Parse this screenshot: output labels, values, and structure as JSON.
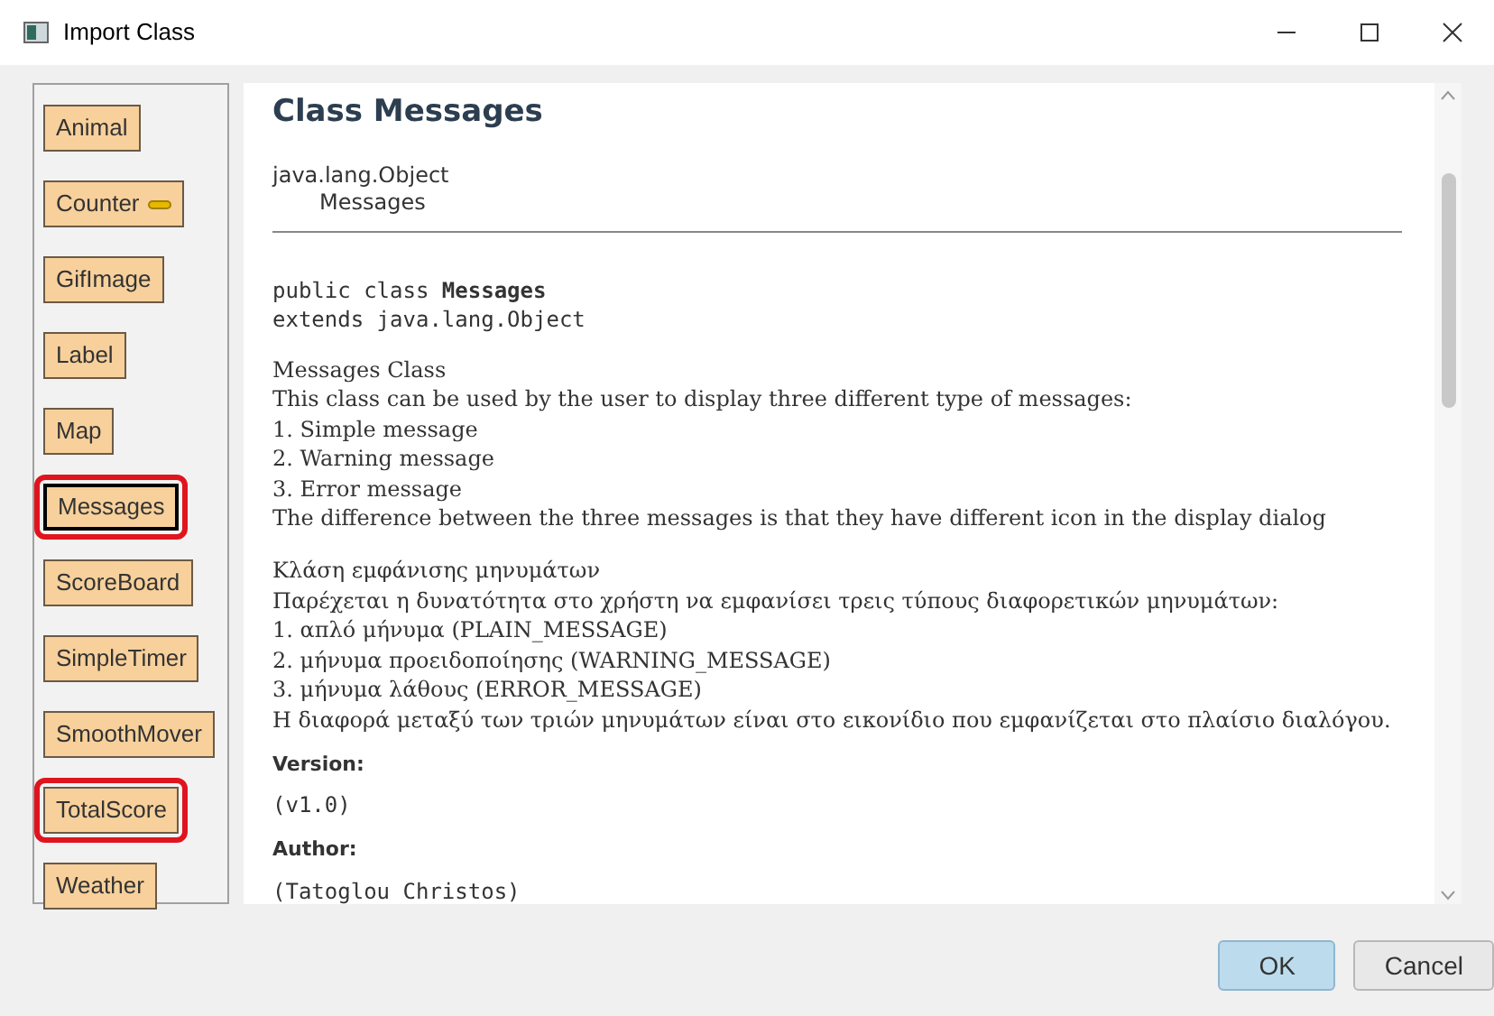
{
  "window": {
    "title": "Import Class"
  },
  "classes": [
    {
      "name": "Animal",
      "selected": false,
      "highlighted": false,
      "kind": "plain"
    },
    {
      "name": "Counter",
      "selected": false,
      "highlighted": false,
      "kind": "actor"
    },
    {
      "name": "GifImage",
      "selected": false,
      "highlighted": false,
      "kind": "plain"
    },
    {
      "name": "Label",
      "selected": false,
      "highlighted": false,
      "kind": "plain"
    },
    {
      "name": "Map",
      "selected": false,
      "highlighted": false,
      "kind": "plain"
    },
    {
      "name": "Messages",
      "selected": true,
      "highlighted": true,
      "kind": "plain"
    },
    {
      "name": "ScoreBoard",
      "selected": false,
      "highlighted": false,
      "kind": "plain"
    },
    {
      "name": "SimpleTimer",
      "selected": false,
      "highlighted": false,
      "kind": "plain"
    },
    {
      "name": "SmoothMover",
      "selected": false,
      "highlighted": false,
      "kind": "plain"
    },
    {
      "name": "TotalScore",
      "selected": false,
      "highlighted": true,
      "kind": "plain"
    },
    {
      "name": "Weather",
      "selected": false,
      "highlighted": false,
      "kind": "plain"
    }
  ],
  "doc": {
    "title": "Class Messages",
    "hierarchy": [
      "java.lang.Object",
      "Messages"
    ],
    "signature": [
      "public class **Messages**",
      "extends java.lang.Object"
    ],
    "paragraphs": [
      [
        "Messages Class",
        "This class can be used by the user to display three different type of messages:",
        "1. Simple message",
        "2. Warning message",
        "3. Error message",
        "The difference between the three messages is that they have different icon in the display dialog"
      ],
      [
        "Κλάση εμφάνισης μηνυμάτων",
        "Παρέχεται η δυνατότητα στο χρήστη να εμφανίσει τρεις τύπους διαφορετικών μηνυμάτων:",
        "1. απλό μήνυμα (PLAIN_MESSAGE)",
        "2. μήνυμα προειδοποίησης (WARNING_MESSAGE)",
        "3. μήνυμα λάθους (ERROR_MESSAGE)",
        "Η διαφορά μεταξύ των τριών μηνυμάτων είναι στο εικονίδιο που εμφανίζεται στο πλαίσιο διαλόγου."
      ]
    ],
    "tags": [
      {
        "label": "Version:",
        "value": "(v1.0)"
      },
      {
        "label": "Author:",
        "value": "(Tatoglou Christos)"
      }
    ]
  },
  "buttons": [
    {
      "label": "OK",
      "kind": "default"
    },
    {
      "label": "Cancel",
      "kind": "normal"
    }
  ]
}
